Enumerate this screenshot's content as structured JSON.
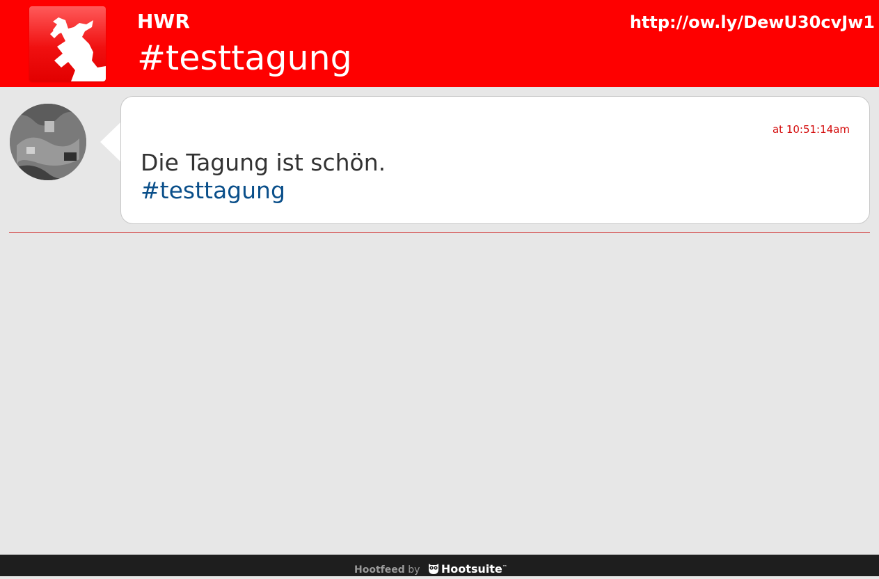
{
  "header": {
    "org_name": "HWR",
    "hashtag": "#testtagung",
    "short_url": "http://ow.ly/DewU30cvJw1",
    "background_color": "#fe0000",
    "logo_icon": "berlin-bear-icon"
  },
  "feed": {
    "posts": [
      {
        "avatar_icon": "user-avatar",
        "timestamp": "at 10:51:14am",
        "text": "Die Tagung ist schön.",
        "hashtag": "#testtagung",
        "hashtag_color": "#0a4f8a",
        "timestamp_color": "#d40b0b"
      }
    ]
  },
  "footer": {
    "product": "Hootfeed",
    "by": "by",
    "brand": "Hootsuite",
    "trademark": "™",
    "brand_icon": "hootsuite-owl-icon"
  }
}
